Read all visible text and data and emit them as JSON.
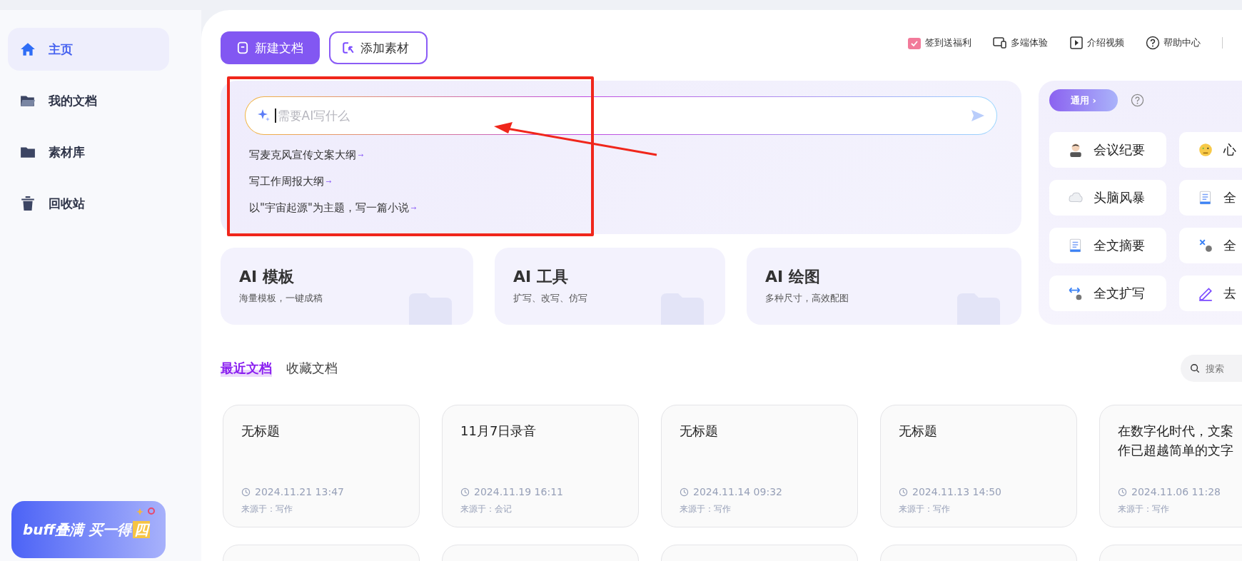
{
  "sidebar": {
    "items": [
      {
        "label": "主页",
        "selected": true
      },
      {
        "label": "我的文档",
        "selected": false
      },
      {
        "label": "素材库",
        "selected": false
      },
      {
        "label": "回收站",
        "selected": false
      }
    ],
    "promo": {
      "text": "buff叠满 买一得",
      "highlight": "四"
    }
  },
  "toolbar": {
    "buttons": [
      {
        "label": "新建文档",
        "kind": "primary"
      },
      {
        "label": "添加素材",
        "kind": "outline"
      }
    ],
    "links": [
      "签到送福利",
      "多端体验",
      "介绍视频",
      "帮助中心"
    ]
  },
  "ai_input": {
    "placeholder": "需要AI写什么",
    "suggestions": [
      "写麦克风宣传文案大纲",
      "写工作周报大纲",
      "以\"宇宙起源\"为主题，写一篇小说"
    ]
  },
  "features": [
    {
      "title": "AI 模板",
      "subtitle": "海量模板，一键成稿"
    },
    {
      "title": "AI 工具",
      "subtitle": "扩写、改写、仿写"
    },
    {
      "title": "AI 绘图",
      "subtitle": "多种尺寸，高效配图"
    }
  ],
  "tools_panel": {
    "category": "通用 ›",
    "tools": [
      "会议纪要",
      "心",
      "头脑风暴",
      "全",
      "全文摘要",
      "全",
      "全文扩写",
      "去"
    ]
  },
  "doc_tabs": [
    {
      "label": "最近文档",
      "selected": true
    },
    {
      "label": "收藏文档",
      "selected": false
    }
  ],
  "doc_search": {
    "placeholder": "搜索"
  },
  "documents": [
    {
      "title_lines": [
        "无标题"
      ],
      "time": "2024.11.21 13:47",
      "source": "来源于：写作"
    },
    {
      "title_lines": [
        "11月7日录音"
      ],
      "time": "2024.11.19 16:11",
      "source": "来源于：会记"
    },
    {
      "title_lines": [
        "无标题"
      ],
      "time": "2024.11.14 09:32",
      "source": "来源于：写作"
    },
    {
      "title_lines": [
        "无标题"
      ],
      "time": "2024.11.13 14:50",
      "source": "来源于：写作"
    },
    {
      "title_lines": [
        "在数字化时代，文案",
        "作已超越简单的文字"
      ],
      "time": "2024.11.06 11:28",
      "source": "来源于：写作"
    }
  ]
}
